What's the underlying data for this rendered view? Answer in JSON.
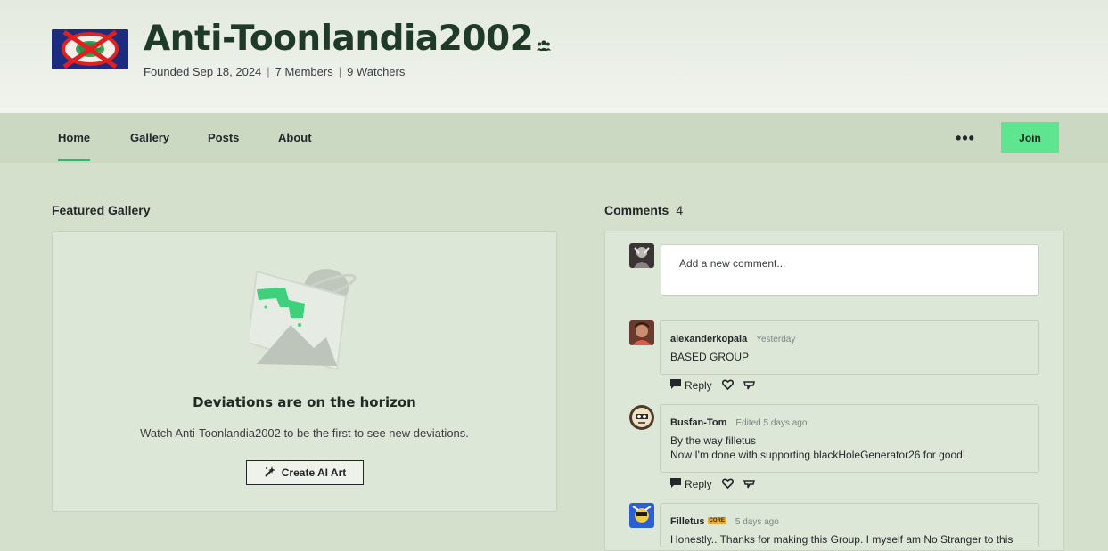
{
  "group": {
    "name": "Anti-Toonlandia2002",
    "founded": "Founded Sep 18, 2024",
    "members": "7 Members",
    "watchers": "9 Watchers",
    "separator": "|"
  },
  "nav": {
    "tabs": [
      {
        "label": "Home",
        "active": true
      },
      {
        "label": "Gallery",
        "active": false
      },
      {
        "label": "Posts",
        "active": false
      },
      {
        "label": "About",
        "active": false
      }
    ],
    "more": "•••",
    "join": "Join"
  },
  "gallery": {
    "heading": "Featured Gallery",
    "empty_title": "Deviations are on the horizon",
    "empty_text": "Watch Anti-Toonlandia2002 to be the first to see new deviations.",
    "create_button": "Create AI Art"
  },
  "comments": {
    "heading": "Comments",
    "count": "4",
    "placeholder": "Add a new comment...",
    "reply_label": "Reply",
    "items": [
      {
        "author": "alexanderkopala",
        "time": "Yesterday",
        "text": [
          "BASED GROUP"
        ]
      },
      {
        "author": "Busfan-Tom",
        "time": "Edited 5 days ago",
        "text": [
          "By the way filletus",
          "Now I'm done with supporting blackHoleGenerator26 for good!"
        ]
      },
      {
        "author": "Filletus",
        "badge": "CORE",
        "time": "5 days ago",
        "text": [
          "Honestly.. Thanks for making this Group. I myself am No Stranger to this"
        ]
      }
    ]
  },
  "colors": {
    "page_background": "#d4dfcc",
    "join_button": "#5fe48f",
    "active_tab_underline": "#2fb86a",
    "title_text": "#1f3a26"
  }
}
